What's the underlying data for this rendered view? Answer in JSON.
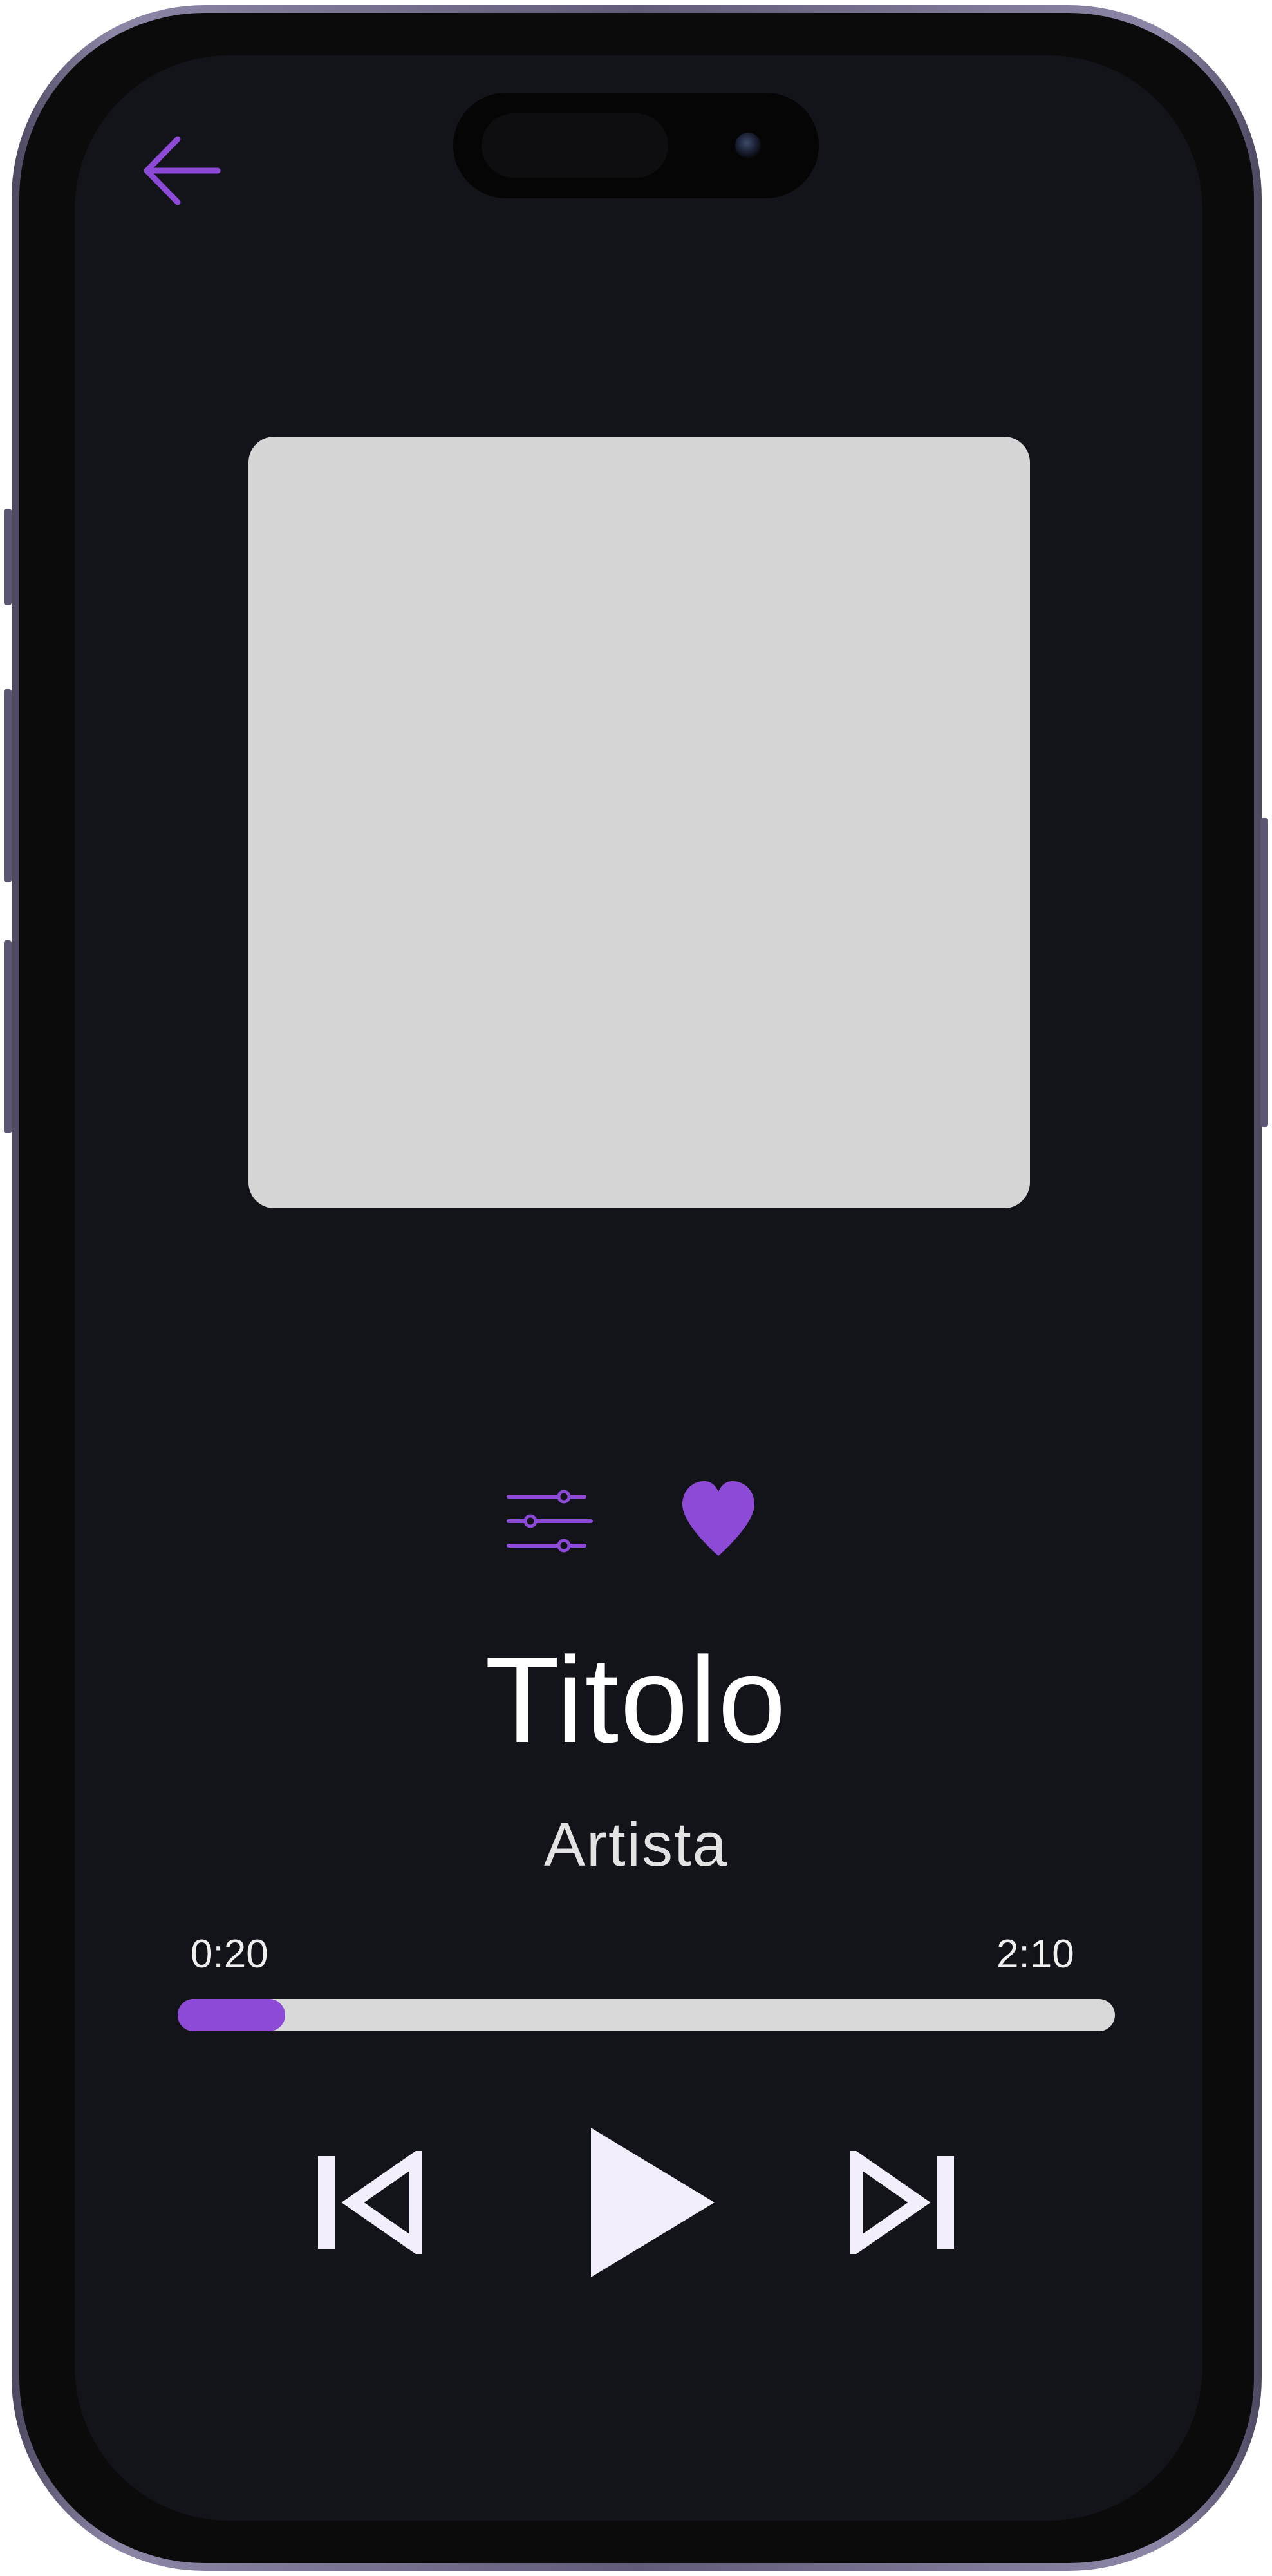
{
  "colors": {
    "accent": "#8c4ad6",
    "background": "#13131a",
    "album_placeholder": "#d6d6d6",
    "progress_track": "#d9d9d9",
    "control": "#f3eefc"
  },
  "header": {
    "back_icon": "arrow-left-icon"
  },
  "album": {
    "artwork_icon": "album-art-placeholder"
  },
  "actions": {
    "equalizer_icon": "sliders-icon",
    "favorite_icon": "heart-icon"
  },
  "track": {
    "title": "Titolo",
    "artist": "Artista"
  },
  "progress": {
    "elapsed": "0:20",
    "total": "2:10",
    "fraction": 0.115
  },
  "controls": {
    "previous_icon": "skip-previous-icon",
    "play_icon": "play-icon",
    "next_icon": "skip-next-icon"
  }
}
